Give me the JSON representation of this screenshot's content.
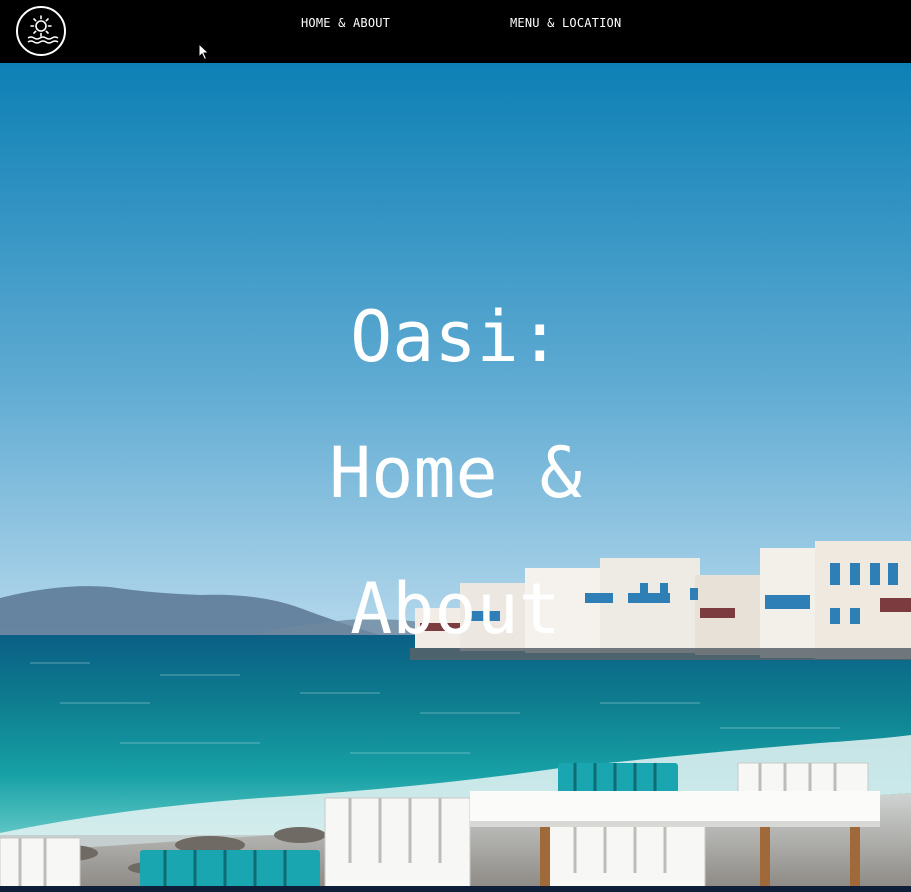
{
  "nav": {
    "logo_icon": "sun-over-waves-icon",
    "links": [
      {
        "label": "HOME & ABOUT"
      },
      {
        "label": "MENU & LOCATION"
      }
    ]
  },
  "hero": {
    "title_lines": [
      "Oasi:",
      "Home &",
      "About"
    ]
  },
  "colors": {
    "nav_background": "#000000",
    "sky_top": "#0d80b5",
    "sky_bottom": "#a9d2ea",
    "sea": "#0e8e9a",
    "text": "#ffffff"
  }
}
